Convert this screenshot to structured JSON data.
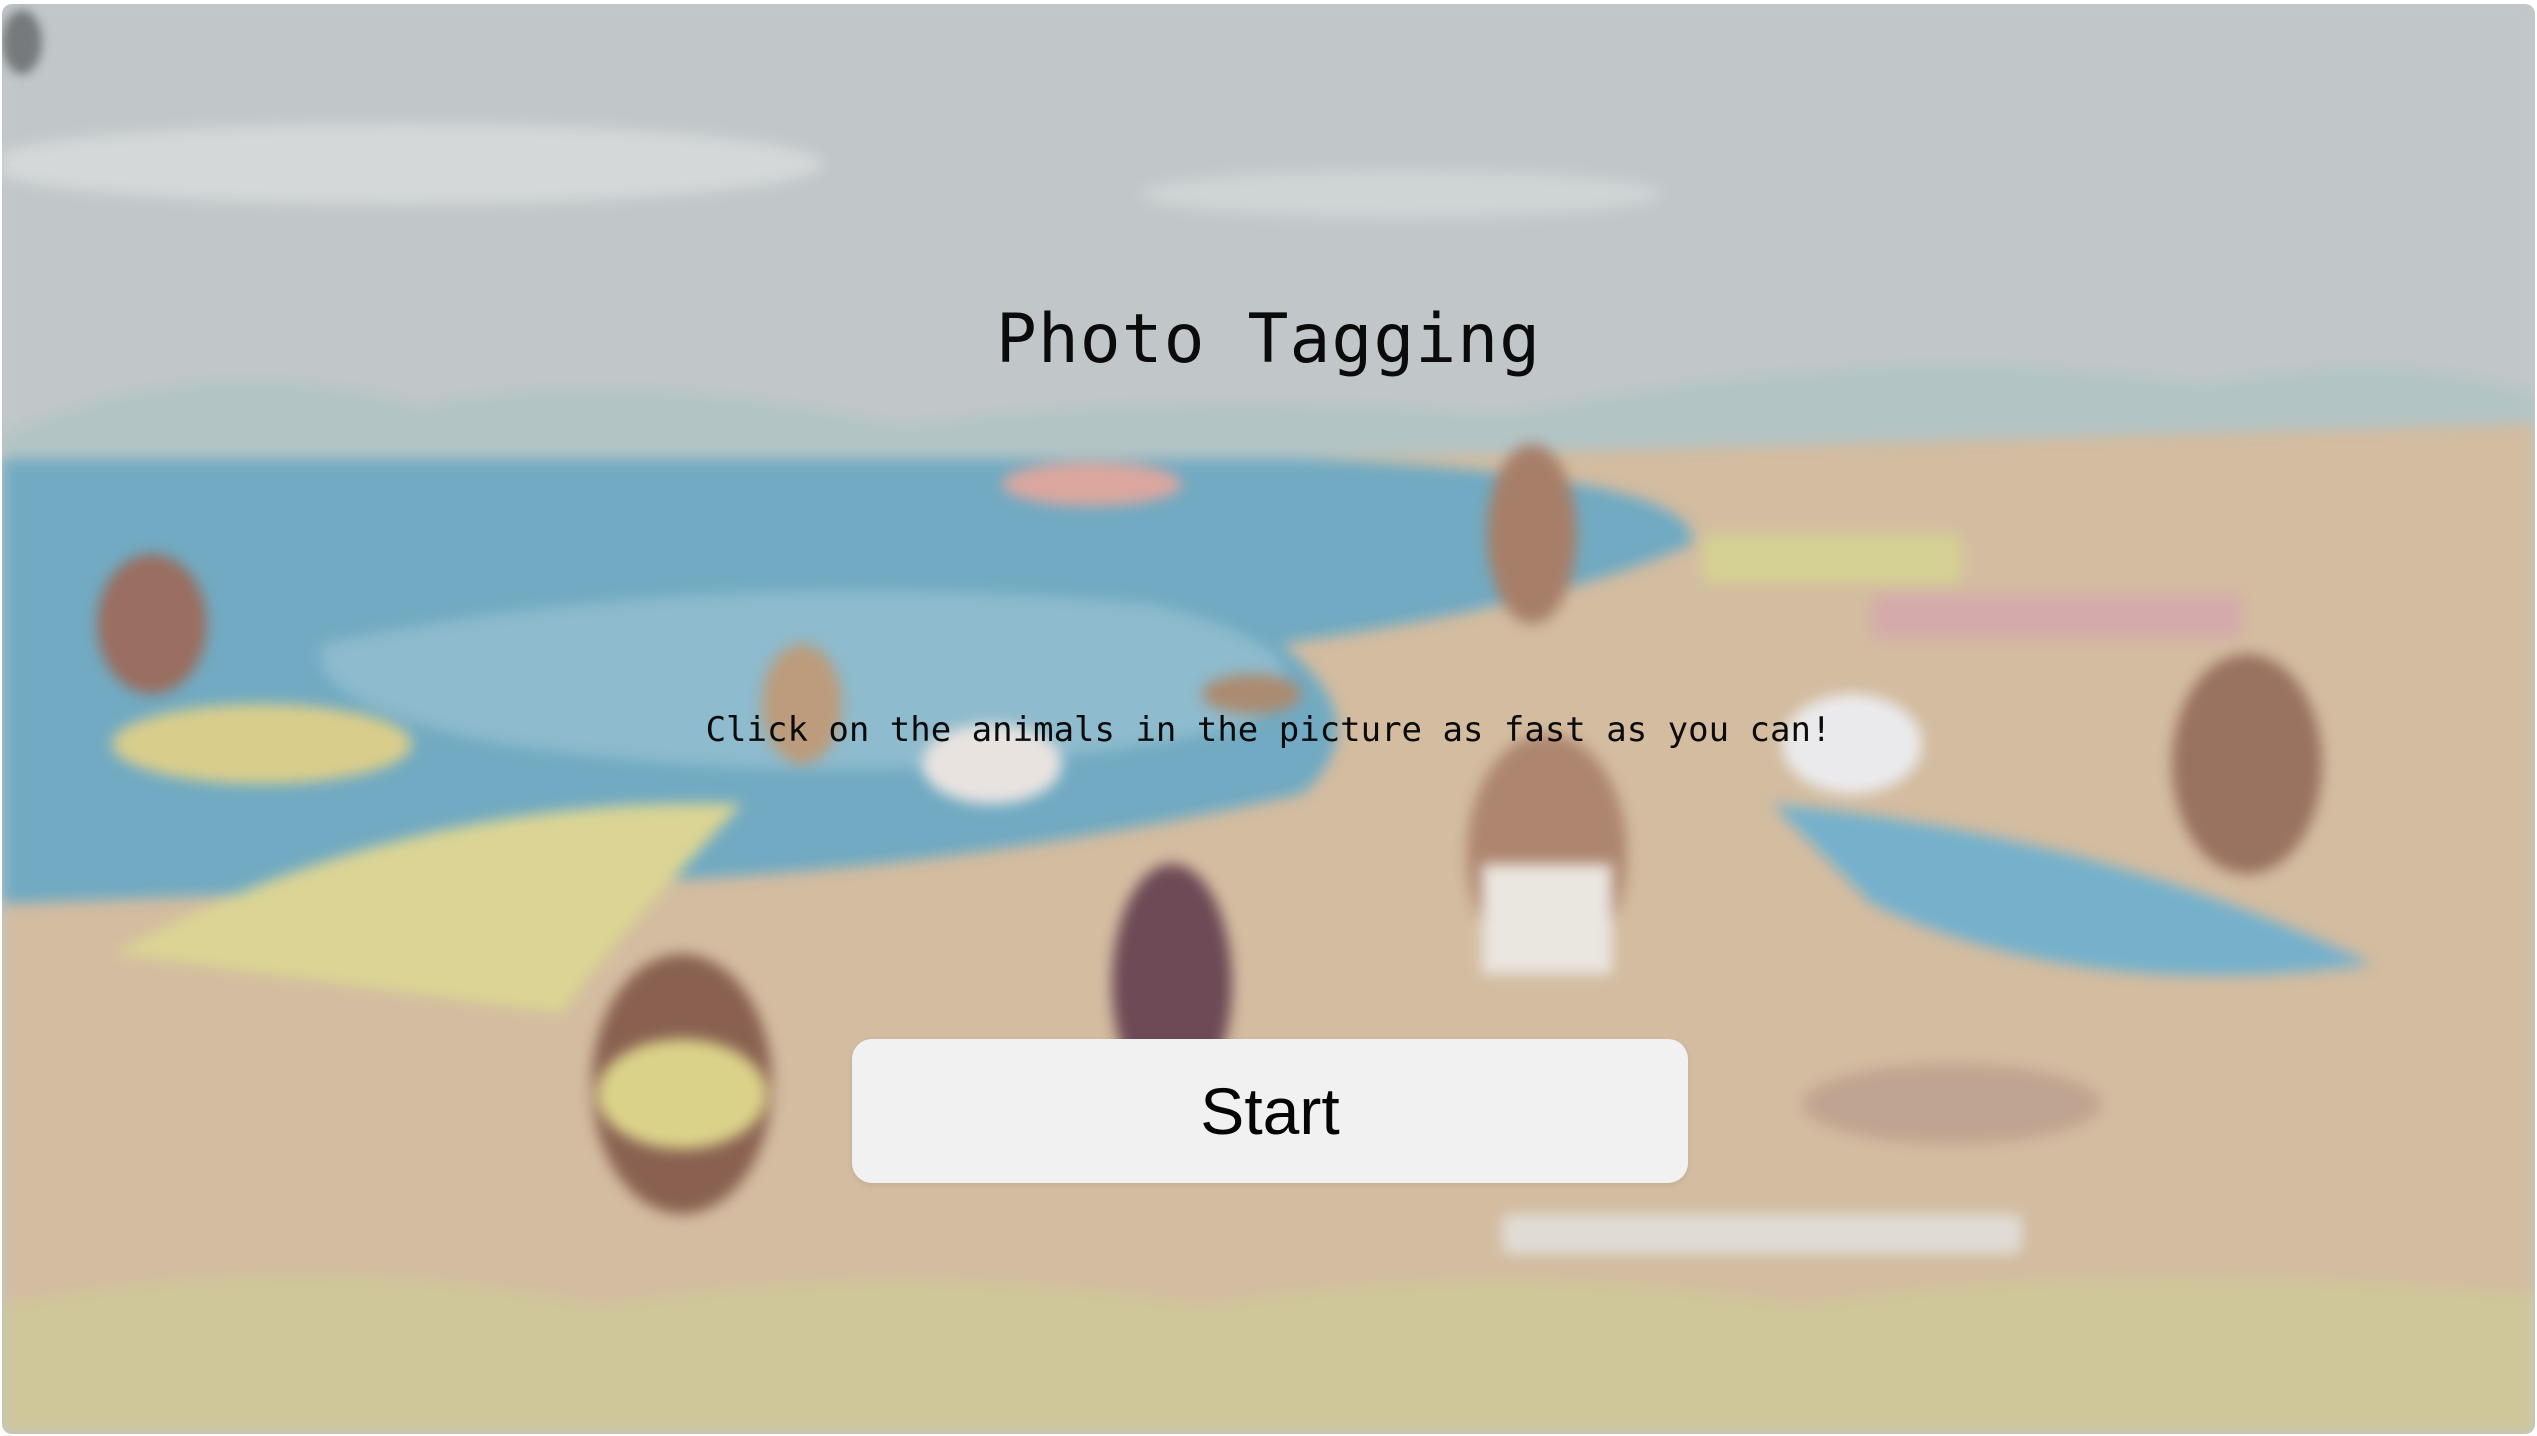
{
  "page": {
    "title": "Photo Tagging",
    "instructions": "Click on the animals in the picture as fast as you can!",
    "start_label": "Start"
  },
  "colors": {
    "sky": "#b9c0c2",
    "sea": "#5e9fba",
    "sand": "#cdb393",
    "button_bg": "#f2f1f2",
    "text": "#0b0b0b"
  },
  "background": {
    "icon": "beach-scene-illustration",
    "blurred": true
  }
}
